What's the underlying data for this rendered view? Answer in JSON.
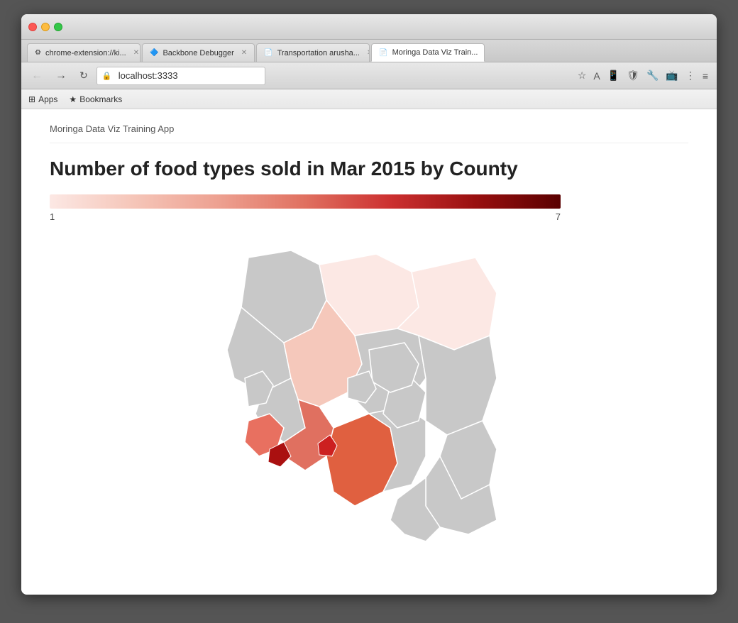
{
  "browser": {
    "tabs": [
      {
        "id": "tab1",
        "label": "chrome-extension://ki...",
        "icon": "⚙",
        "active": false
      },
      {
        "id": "tab2",
        "label": "Backbone Debugger",
        "icon": "🔷",
        "active": false
      },
      {
        "id": "tab3",
        "label": "Transportation arusha...",
        "icon": "📄",
        "active": false
      },
      {
        "id": "tab4",
        "label": "Moringa Data Viz Train...",
        "icon": "📄",
        "active": true
      }
    ],
    "address": "localhost:3333",
    "nav": {
      "back": "←",
      "forward": "→",
      "refresh": "↺"
    }
  },
  "bookmarks": {
    "apps_label": "Apps",
    "bookmarks_label": "Bookmarks"
  },
  "page": {
    "app_title": "Moringa Data Viz Training App",
    "chart_title": "Number of food types sold in Mar 2015 by County",
    "legend": {
      "min": "1",
      "max": "7"
    }
  },
  "colors": {
    "legend_start": "#fce8e4",
    "legend_end": "#5a0000",
    "map_default": "#c8c8c8",
    "accent": "#1a73e8"
  }
}
